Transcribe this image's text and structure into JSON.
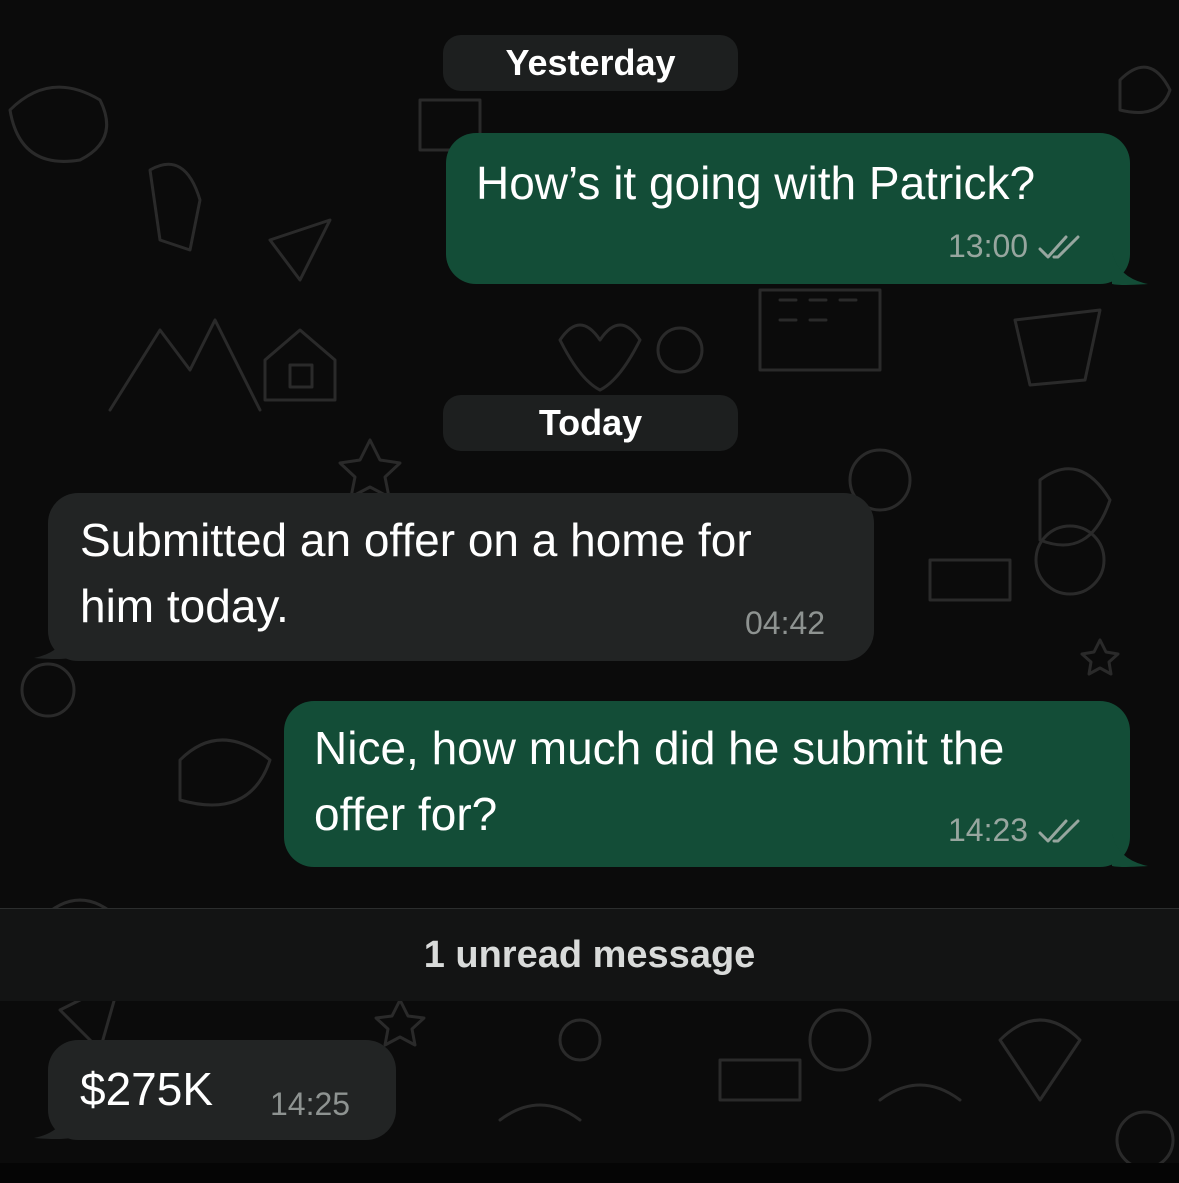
{
  "colors": {
    "background": "#0b0b0b",
    "outgoing_bubble": "#134d37",
    "incoming_bubble": "#222424",
    "date_pill": "#1d1f1f",
    "read_ticks": "#97a69f"
  },
  "dates": {
    "yesterday": "Yesterday",
    "today": "Today"
  },
  "messages": [
    {
      "direction": "outgoing",
      "text": "How’s it going with Patrick?",
      "time": "13:00",
      "status_icon": "double-check-icon"
    },
    {
      "direction": "incoming",
      "text": "Submitted an offer on a home for\nhim today.",
      "time": "04:42"
    },
    {
      "direction": "outgoing",
      "text": "Nice, how much did he submit the\noffer for?",
      "time": "14:23",
      "status_icon": "double-check-icon"
    },
    {
      "direction": "incoming",
      "text": "$275K",
      "time": "14:25"
    }
  ],
  "unread_divider": "1 unread message"
}
